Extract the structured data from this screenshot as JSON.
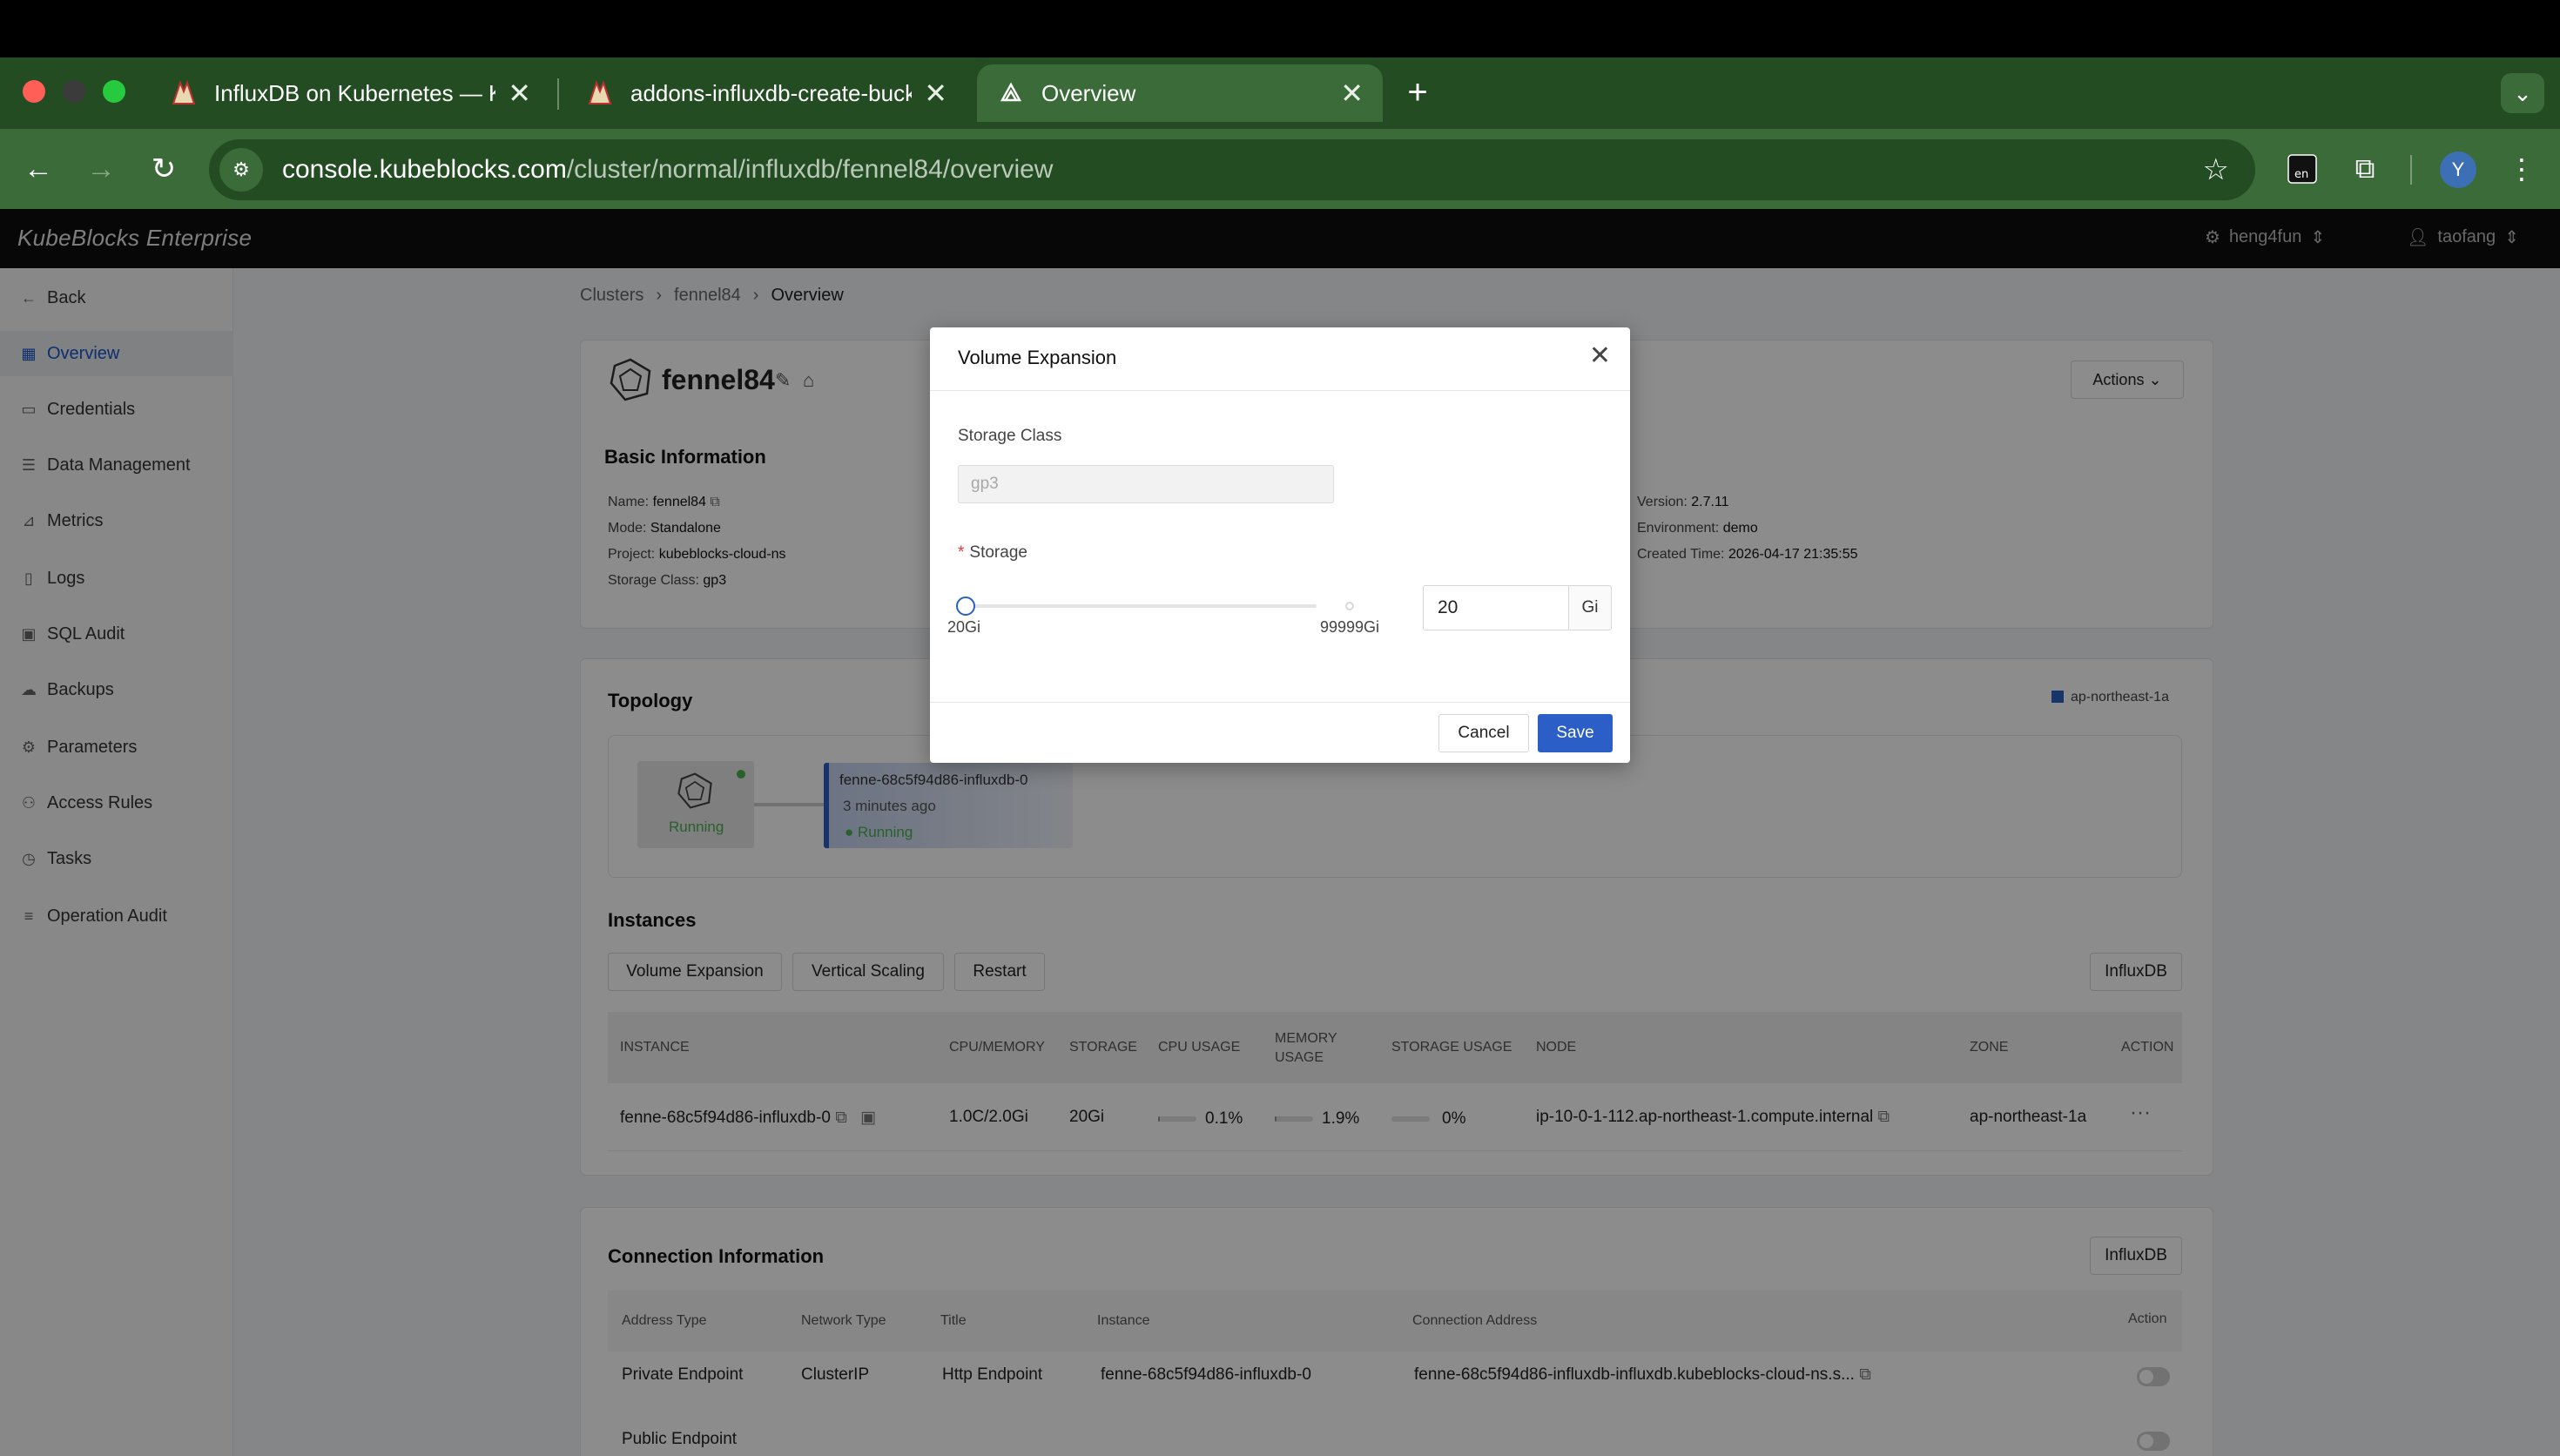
{
  "browser": {
    "tabs": [
      {
        "title": "InfluxDB on Kubernetes — Ku",
        "favicon": "kubeblocks-logo-icon"
      },
      {
        "title": "addons-influxdb-create-buck",
        "favicon": "kubeblocks-logo-icon"
      },
      {
        "title": "Overview",
        "favicon": "kubeblocks-console-icon",
        "active": true
      }
    ],
    "url_host": "console.kubeblocks.com",
    "url_path": "/cluster/normal/influxdb/fennel84/overview",
    "profile_initial": "Y",
    "extension_label": "en"
  },
  "app": {
    "brand": "KubeBlocks Enterprise",
    "org": "heng4fun",
    "user": "taofang"
  },
  "sidebar": {
    "items": [
      {
        "label": "Back",
        "icon": "arrow-left-icon"
      },
      {
        "label": "Overview",
        "icon": "grid-icon",
        "active": true
      },
      {
        "label": "Credentials",
        "icon": "id-card-icon"
      },
      {
        "label": "Data Management",
        "icon": "database-icon"
      },
      {
        "label": "Metrics",
        "icon": "chart-icon"
      },
      {
        "label": "Logs",
        "icon": "file-icon"
      },
      {
        "label": "SQL Audit",
        "icon": "audit-icon"
      },
      {
        "label": "Backups",
        "icon": "cloud-icon"
      },
      {
        "label": "Parameters",
        "icon": "gear-icon"
      },
      {
        "label": "Access Rules",
        "icon": "users-icon"
      },
      {
        "label": "Tasks",
        "icon": "clock-icon"
      },
      {
        "label": "Operation Audit",
        "icon": "list-icon"
      }
    ]
  },
  "breadcrumb": [
    "Clusters",
    "fennel84",
    "Overview"
  ],
  "cluster": {
    "name": "fennel84",
    "actions_label": "Actions",
    "basic_info_title": "Basic Information",
    "name_label": "Name:",
    "name_value": "fennel84",
    "mode_label": "Mode:",
    "mode_value": "Standalone",
    "project_label": "Project:",
    "project_value": "kubeblocks-cloud-ns",
    "storage_class_label": "Storage Class:",
    "storage_class_value": "gp3",
    "version_label": "Version:",
    "version_value": "2.7.11",
    "environment_label": "Environment:",
    "environment_value": "demo",
    "created_label": "Created Time:",
    "created_value": "2026-04-17 21:35:55"
  },
  "topology": {
    "title": "Topology",
    "zone_legend": "ap-northeast-1a",
    "cluster_status": "Running",
    "pod_name": "fenne-68c5f94d86-influxdb-0",
    "pod_age": "3 minutes ago",
    "pod_status": "Running"
  },
  "instances": {
    "title": "Instances",
    "actions": [
      "Volume Expansion",
      "Vertical Scaling",
      "Restart"
    ],
    "component": "InfluxDB",
    "columns": [
      "INSTANCE",
      "CPU/MEMORY",
      "STORAGE",
      "CPU USAGE",
      "MEMORY USAGE",
      "STORAGE USAGE",
      "NODE",
      "ZONE",
      "ACTION"
    ],
    "rows": [
      {
        "instance": "fenne-68c5f94d86-influxdb-0",
        "cpu_memory": "1.0C/2.0Gi",
        "storage": "20Gi",
        "cpu_usage": "0.1%",
        "cpu_usage_value": 0.1,
        "memory_usage": "1.9%",
        "memory_usage_value": 1.9,
        "storage_usage": "0%",
        "storage_usage_value": 0,
        "node": "ip-10-0-1-112.ap-northeast-1.compute.internal",
        "zone": "ap-northeast-1a",
        "action": "···"
      }
    ]
  },
  "connection": {
    "title": "Connection Information",
    "component": "InfluxDB",
    "columns": [
      "Address Type",
      "Network Type",
      "Title",
      "Instance",
      "Connection Address",
      "Action"
    ],
    "rows": [
      {
        "address_type": "Private Endpoint",
        "network_type": "ClusterIP",
        "title": "Http Endpoint",
        "instance": "fenne-68c5f94d86-influxdb-0",
        "address": "fenne-68c5f94d86-influxdb-influxdb.kubeblocks-cloud-ns.s...",
        "enabled": false
      },
      {
        "address_type": "Public Endpoint",
        "enabled": false
      }
    ]
  },
  "modal": {
    "title": "Volume Expansion",
    "storage_class_label": "Storage Class",
    "storage_class_value": "gp3",
    "storage_label": "Storage",
    "required_mark": "*",
    "slider_min": "20Gi",
    "slider_max": "99999Gi",
    "slider_value": 20,
    "storage_value": "20",
    "unit": "Gi",
    "cancel_label": "Cancel",
    "save_label": "Save"
  },
  "colors": {
    "chrome_dark": "#234c22",
    "chrome_active": "#3a6b38",
    "primary": "#2b5fc7",
    "running": "#4caf50"
  }
}
